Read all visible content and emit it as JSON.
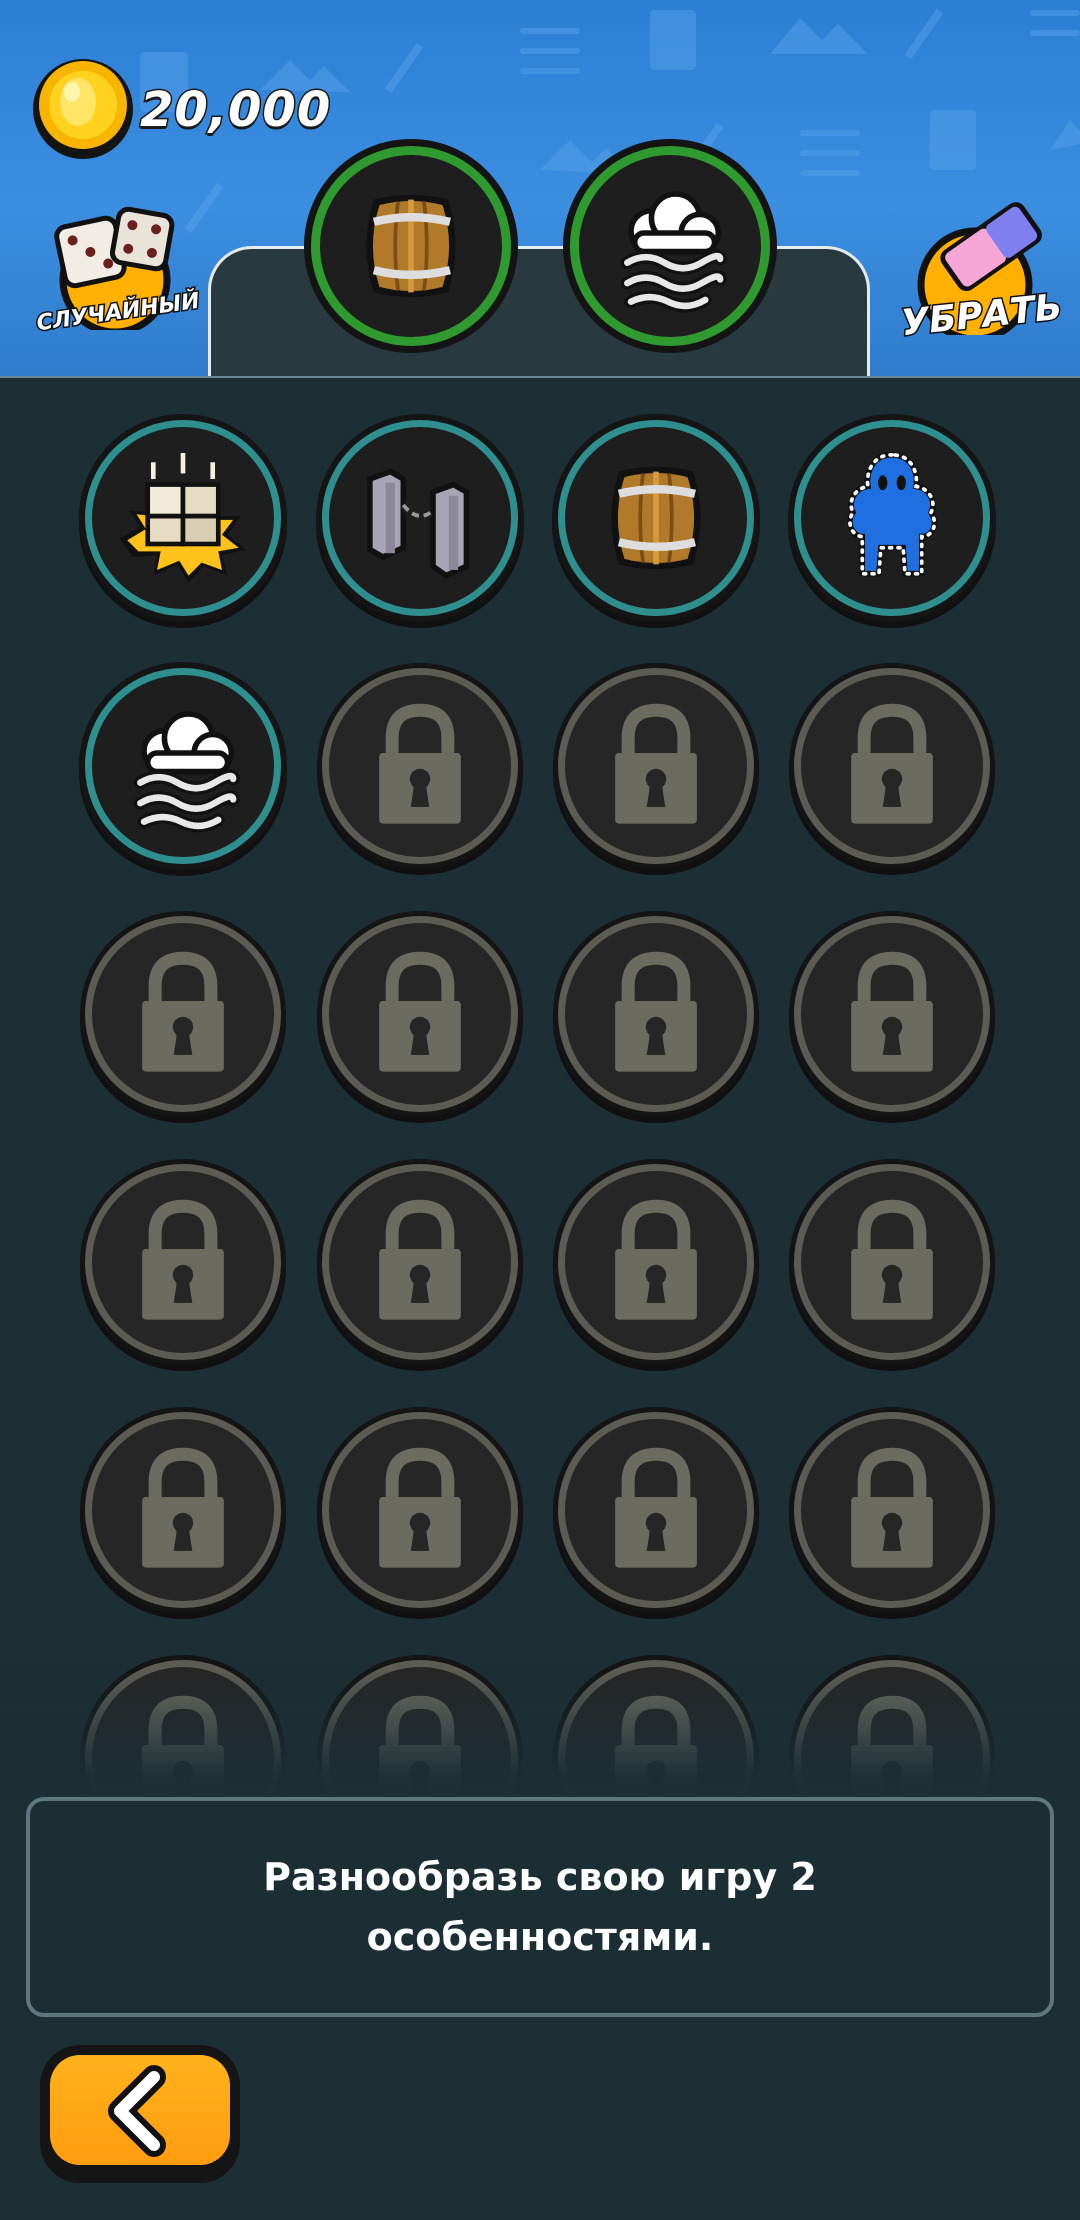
{
  "header": {
    "coins": "20,000",
    "random_label": "СЛУЧАЙНЫЙ",
    "remove_label": "УБРАТЬ",
    "selected": [
      {
        "id": "barrel",
        "icon": "barrel-icon"
      },
      {
        "id": "fog",
        "icon": "fog-icon"
      }
    ]
  },
  "grid": {
    "items": [
      {
        "icon": "pillars-icon",
        "locked": false
      },
      {
        "icon": "chained-posts-icon",
        "locked": false
      },
      {
        "icon": "barrel-icon",
        "locked": false
      },
      {
        "icon": "ghost-icon",
        "locked": false
      },
      {
        "icon": "fog-icon",
        "locked": false
      },
      {
        "icon": "lock-icon",
        "locked": true
      },
      {
        "icon": "lock-icon",
        "locked": true
      },
      {
        "icon": "lock-icon",
        "locked": true
      },
      {
        "icon": "lock-icon",
        "locked": true
      },
      {
        "icon": "lock-icon",
        "locked": true
      },
      {
        "icon": "lock-icon",
        "locked": true
      },
      {
        "icon": "lock-icon",
        "locked": true
      },
      {
        "icon": "lock-icon",
        "locked": true
      },
      {
        "icon": "lock-icon",
        "locked": true
      },
      {
        "icon": "lock-icon",
        "locked": true
      },
      {
        "icon": "lock-icon",
        "locked": true
      },
      {
        "icon": "lock-icon",
        "locked": true
      },
      {
        "icon": "lock-icon",
        "locked": true
      },
      {
        "icon": "lock-icon",
        "locked": true
      },
      {
        "icon": "lock-icon",
        "locked": true
      },
      {
        "icon": "lock-icon",
        "locked": true
      },
      {
        "icon": "lock-icon",
        "locked": true
      },
      {
        "icon": "lock-icon",
        "locked": true
      },
      {
        "icon": "lock-icon",
        "locked": true
      }
    ]
  },
  "info": {
    "text": "Разнообразь свою игру 2 особенностями."
  },
  "colors": {
    "header_blue": "#3b8ee0",
    "selected_ring": "#2f9a2f",
    "unlocked_ring": "#2f8f8f",
    "locked_ring": "#5c5c54",
    "back_button": "#ffa514",
    "background": "#1c2f35"
  }
}
